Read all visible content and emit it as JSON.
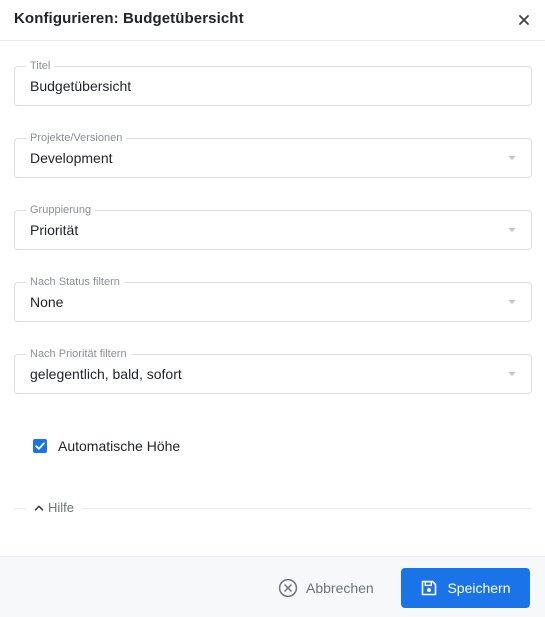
{
  "dialog": {
    "title": "Konfigurieren: Budgetübersicht",
    "close_icon": "close-icon"
  },
  "fields": {
    "title": {
      "label": "Titel",
      "value": "Budgetübersicht"
    },
    "projects": {
      "label": "Projekte/Versionen",
      "value": "Development"
    },
    "grouping": {
      "label": "Gruppierung",
      "value": "Priorität"
    },
    "status_filter": {
      "label": "Nach Status filtern",
      "value": "None"
    },
    "priority_filter": {
      "label": "Nach Priorität filtern",
      "value": "gelegentlich, bald, sofort"
    }
  },
  "auto_height": {
    "label": "Automatische Höhe",
    "checked": true
  },
  "help": {
    "label": "Hilfe",
    "icon": "chevron-up-icon"
  },
  "footer": {
    "cancel_label": "Abbrechen",
    "cancel_icon": "x-circle-icon",
    "save_label": "Speichern",
    "save_icon": "floppy-disk-icon"
  },
  "colors": {
    "accent": "#1a73e8",
    "footer_bg": "#f7f8fa"
  }
}
